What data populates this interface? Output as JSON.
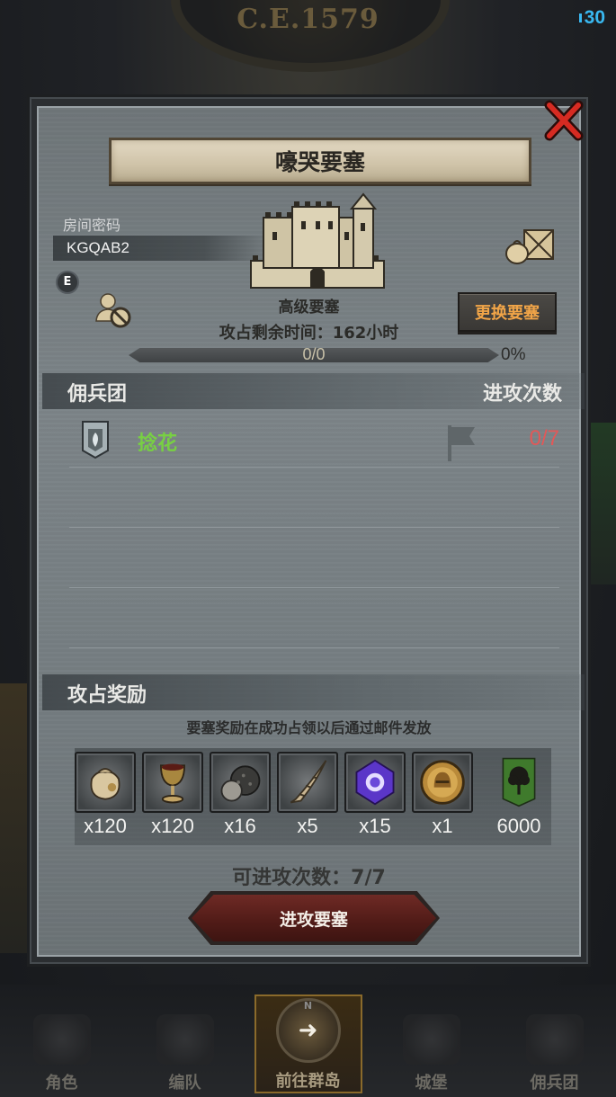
{
  "hud": {
    "era": "C.E.1579",
    "signal": "30"
  },
  "modal": {
    "title": "嚎哭要塞",
    "room_label": "房间密码",
    "room_code": "KGQAB2",
    "badge": "E",
    "fortress_name": "高级要塞",
    "change_button": "更换要塞",
    "occupy_time": "攻占剩余时间：162小时",
    "progress": {
      "text": "0/0",
      "percent_text": "0%",
      "fraction": 0
    },
    "mercenary_section": {
      "title": "佣兵团",
      "attacks_header": "进攻次数"
    },
    "teams": [
      {
        "name": "捻花",
        "attacks": "0/7"
      }
    ],
    "rewards_section": {
      "title": "攻占奖励",
      "note": "要塞奖励在成功占领以后通过邮件发放"
    },
    "rewards": [
      {
        "icon": "sack-icon",
        "qty": "x120"
      },
      {
        "icon": "goblet-icon",
        "qty": "x120"
      },
      {
        "icon": "ore-icon",
        "qty": "x16"
      },
      {
        "icon": "horn-icon",
        "qty": "x5"
      },
      {
        "icon": "rune-gem-icon",
        "qty": "x15"
      },
      {
        "icon": "helmet-coin-icon",
        "qty": "x1"
      },
      {
        "icon": "tree-banner-icon",
        "qty": "6000"
      }
    ],
    "attack_count": "可进攻次数：7/7",
    "attack_button": "进攻要塞"
  },
  "bottom_nav": {
    "items": [
      {
        "label": "角色",
        "icon": "character-icon"
      },
      {
        "label": "编队",
        "icon": "formation-icon"
      },
      {
        "label": "前往群岛",
        "icon": "compass-icon",
        "north": "N",
        "arrow": "➜"
      },
      {
        "label": "城堡",
        "icon": "castle-icon"
      },
      {
        "label": "佣兵团",
        "icon": "mercenary-icon"
      }
    ]
  },
  "colors": {
    "accent_orange": "#f1a548",
    "team_green": "#78d043",
    "attacks_red": "#e25858",
    "signal_blue": "#39b8f0"
  }
}
